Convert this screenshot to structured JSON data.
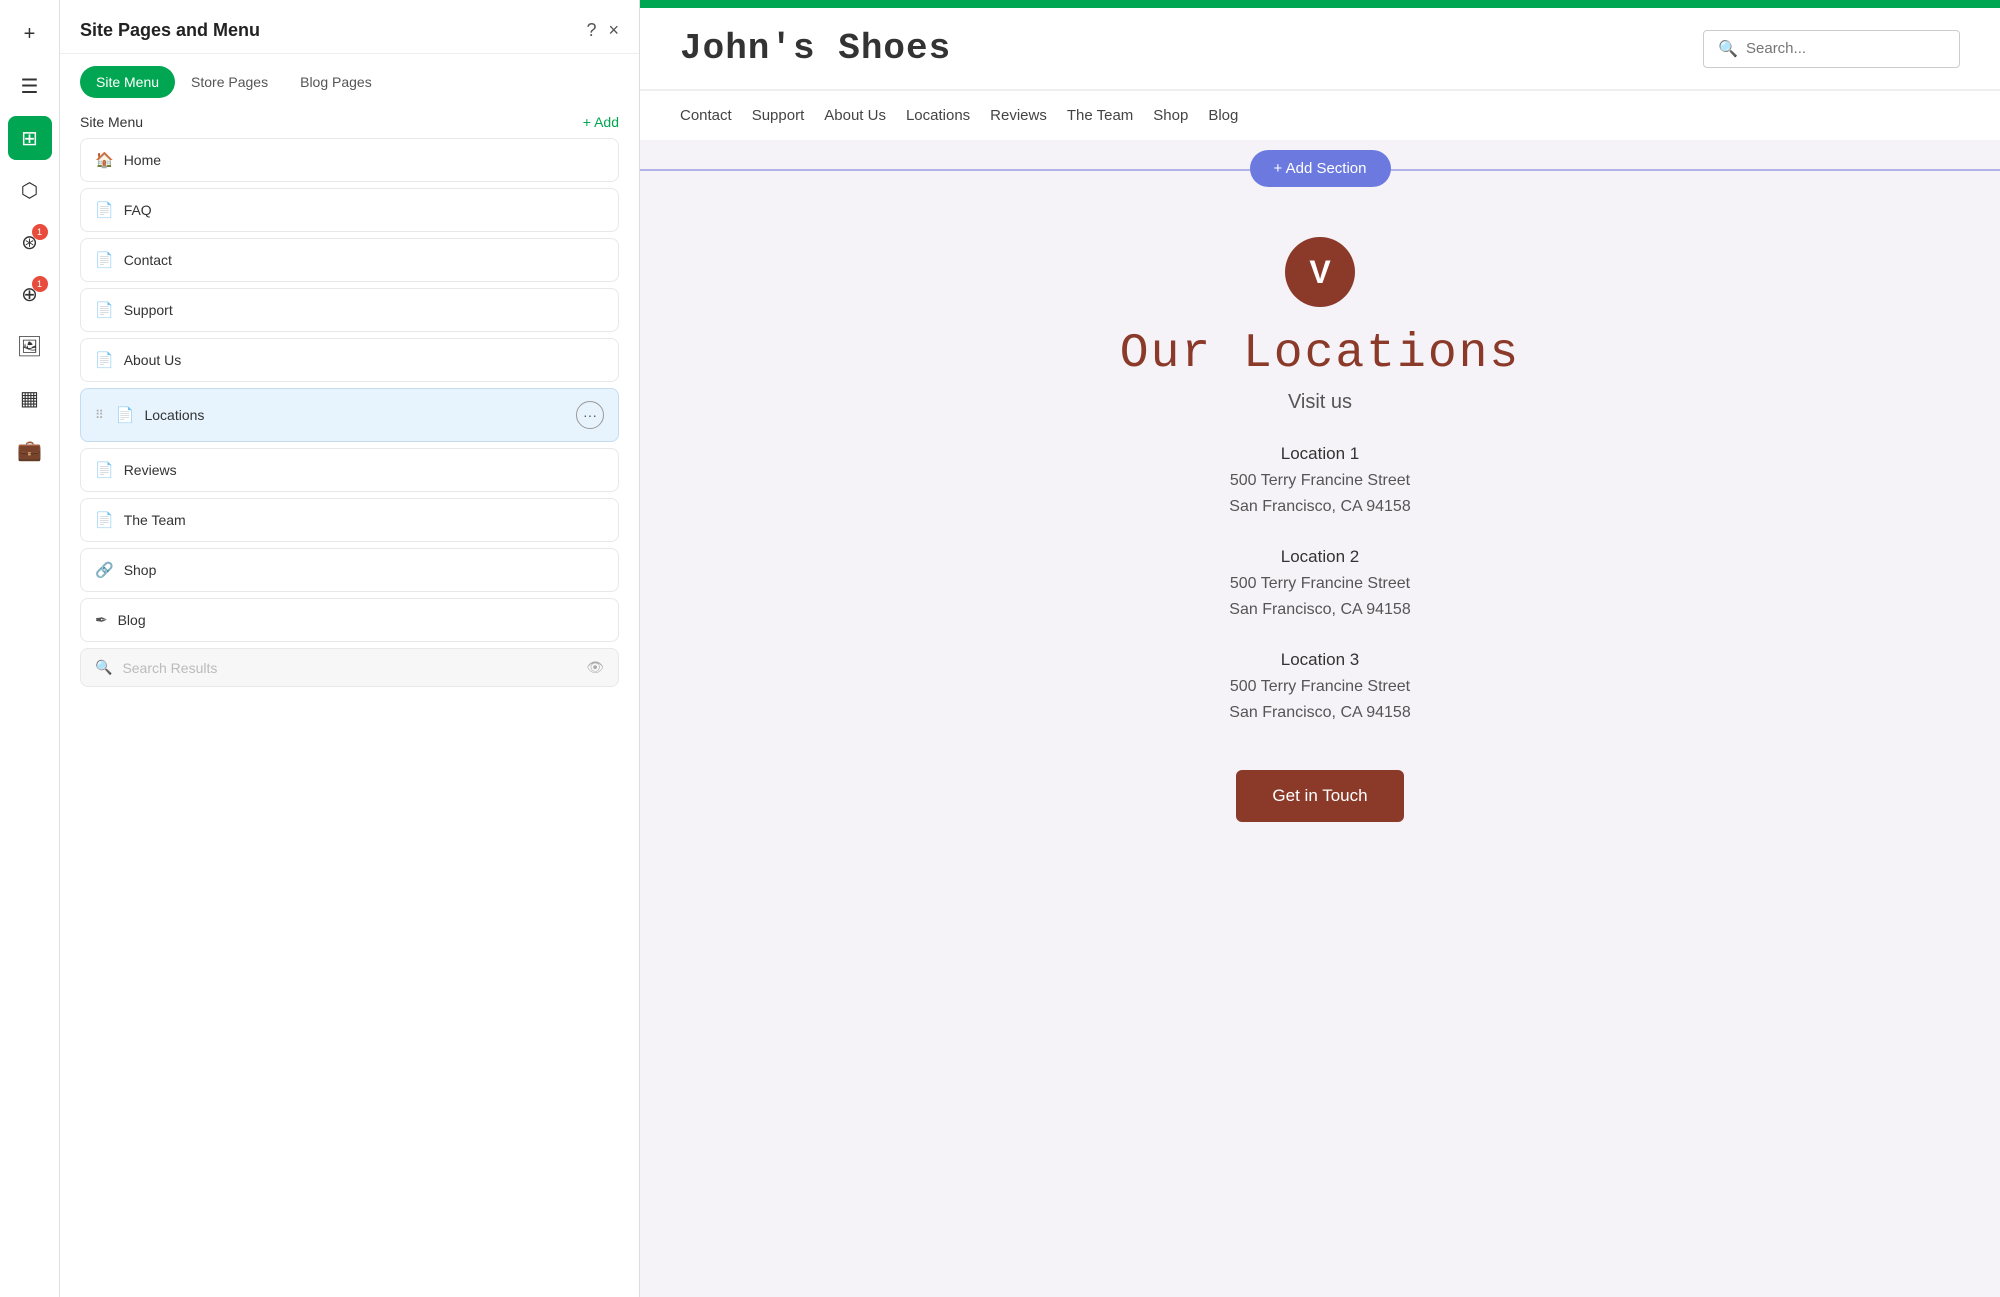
{
  "panel": {
    "title": "Site Pages and Menu",
    "help_icon": "?",
    "close_icon": "×"
  },
  "tabs": [
    {
      "id": "site-menu",
      "label": "Site Menu",
      "active": true
    },
    {
      "id": "store-pages",
      "label": "Store Pages",
      "active": false
    },
    {
      "id": "blog-pages",
      "label": "Blog Pages",
      "active": false
    }
  ],
  "section_header": {
    "label": "Site Menu",
    "add_label": "+ Add"
  },
  "pages": [
    {
      "id": "home",
      "icon": "🏠",
      "name": "Home",
      "active": false,
      "draggable": false
    },
    {
      "id": "faq",
      "icon": "📄",
      "name": "FAQ",
      "active": false,
      "draggable": false
    },
    {
      "id": "contact",
      "icon": "📄",
      "name": "Contact",
      "active": false,
      "draggable": false
    },
    {
      "id": "support",
      "icon": "📄",
      "name": "Support",
      "active": false,
      "draggable": false
    },
    {
      "id": "about-us",
      "icon": "📄",
      "name": "About Us",
      "active": false,
      "draggable": false
    },
    {
      "id": "locations",
      "icon": "📄",
      "name": "Locations",
      "active": true,
      "draggable": true
    },
    {
      "id": "reviews",
      "icon": "📄",
      "name": "Reviews",
      "active": false,
      "draggable": false
    },
    {
      "id": "the-team",
      "icon": "📄",
      "name": "The Team",
      "active": false,
      "draggable": false
    },
    {
      "id": "shop",
      "icon": "🔗",
      "name": "Shop",
      "active": false,
      "draggable": false
    },
    {
      "id": "blog",
      "icon": "✒",
      "name": "Blog",
      "active": false,
      "draggable": false
    }
  ],
  "search_results": {
    "placeholder": "Search Results",
    "visible": false
  },
  "website": {
    "title": "John's Shoes",
    "search_placeholder": "Search...",
    "nav_links": [
      "Contact",
      "Support",
      "About Us",
      "Locations",
      "Reviews",
      "The Team",
      "Shop",
      "Blog"
    ],
    "add_section_label": "+ Add Section",
    "logo_letter": "V",
    "page_heading": "Our Locations",
    "page_subheading": "Visit us",
    "locations": [
      {
        "name": "Location 1",
        "address1": "500 Terry Francine Street",
        "address2": "San Francisco, CA 94158"
      },
      {
        "name": "Location 2",
        "address1": "500 Terry Francine Street",
        "address2": "San Francisco, CA 94158"
      },
      {
        "name": "Location 3",
        "address1": "500 Terry Francine Street",
        "address2": "San Francisco, CA 94158"
      }
    ],
    "cta_button": "Get in Touch"
  },
  "left_icons": [
    {
      "id": "add",
      "symbol": "+",
      "active": false
    },
    {
      "id": "hamburger",
      "symbol": "☰",
      "active": false
    },
    {
      "id": "pages",
      "symbol": "⊞",
      "active": true
    },
    {
      "id": "design",
      "symbol": "⬡",
      "active": false
    },
    {
      "id": "apps",
      "symbol": "⊛",
      "badge": 1,
      "active": false
    },
    {
      "id": "extensions",
      "symbol": "⊕",
      "badge": 1,
      "active": false
    },
    {
      "id": "media",
      "symbol": "🖼",
      "active": false
    },
    {
      "id": "grid",
      "symbol": "▦",
      "active": false
    },
    {
      "id": "briefcase",
      "symbol": "💼",
      "active": false
    }
  ]
}
